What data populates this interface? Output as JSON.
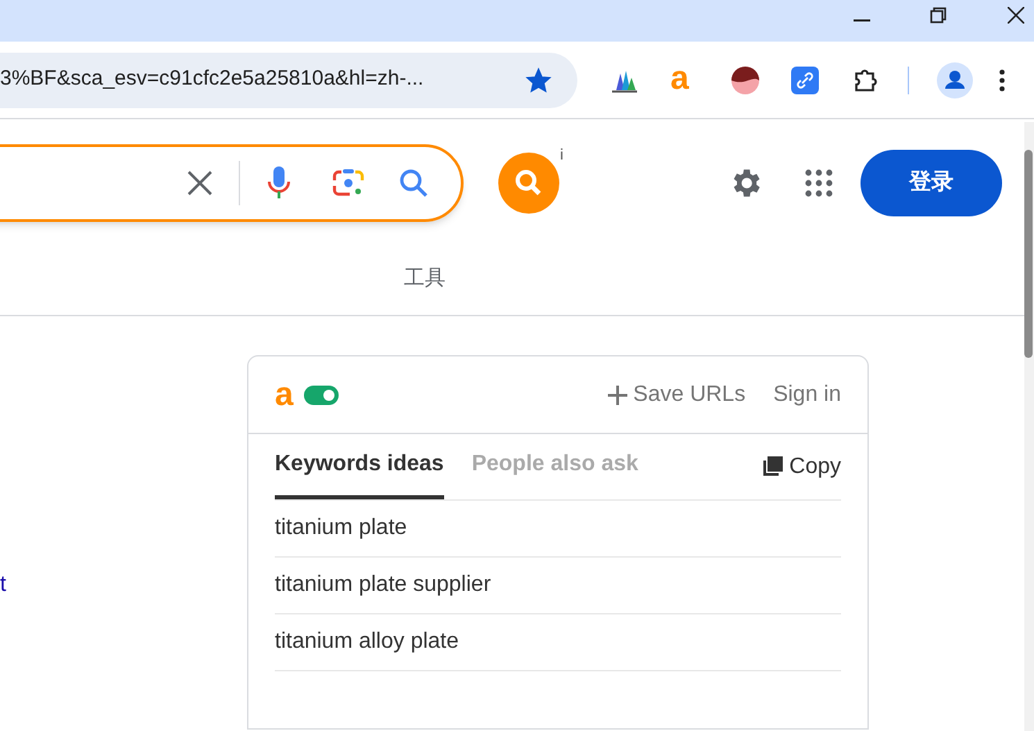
{
  "browser": {
    "address": "3%BF&sca_esv=c91cfc2e5a25810a&hl=zh-...",
    "bookmarked": true
  },
  "search": {
    "tools_tab": "工具",
    "sign_in_button": "登录",
    "extension_badge": "i"
  },
  "extension_icon_letter": "a",
  "side_link": "t",
  "extension_panel": {
    "logo": "a",
    "enabled": true,
    "save_urls": "Save URLs",
    "sign_in": "Sign in",
    "copy": "Copy",
    "tabs": [
      {
        "label": "Keywords ideas",
        "selected": true
      },
      {
        "label": "People also ask",
        "selected": false
      }
    ],
    "keywords": [
      "titanium plate",
      "titanium plate supplier",
      "titanium alloy plate"
    ]
  }
}
